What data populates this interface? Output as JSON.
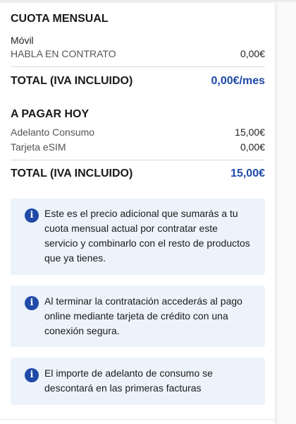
{
  "cuota_mensual": {
    "title": "CUOTA MENSUAL",
    "subheading": "Móvil",
    "items": [
      {
        "label": "HABLA EN CONTRATO",
        "value": "0,00€"
      }
    ],
    "total_label": "TOTAL (IVA INCLUIDO)",
    "total_value": "0,00€/mes"
  },
  "a_pagar_hoy": {
    "title": "A PAGAR HOY",
    "items": [
      {
        "label": "Adelanto Consumo",
        "value": "15,00€"
      },
      {
        "label": "Tarjeta eSIM",
        "value": "0,00€"
      }
    ],
    "total_label": "TOTAL (IVA INCLUIDO)",
    "total_value": "15,00€"
  },
  "info_boxes": [
    {
      "icon": "info-icon",
      "text": "Este es el precio adicional que sumarás a tu cuota mensual actual por contratar este servicio y combinarlo con el resto de productos que ya tienes."
    },
    {
      "icon": "info-icon",
      "text": "Al terminar la contratación accederás al pago online mediante tarjeta de crédito con una conexión segura."
    },
    {
      "icon": "info-icon",
      "text": "El importe de adelanto de consumo se descontará en las primeras facturas"
    }
  ],
  "colors": {
    "accent": "#1f4aa8",
    "info_bg": "#edf3fb",
    "divider": "#d9d9d9"
  }
}
